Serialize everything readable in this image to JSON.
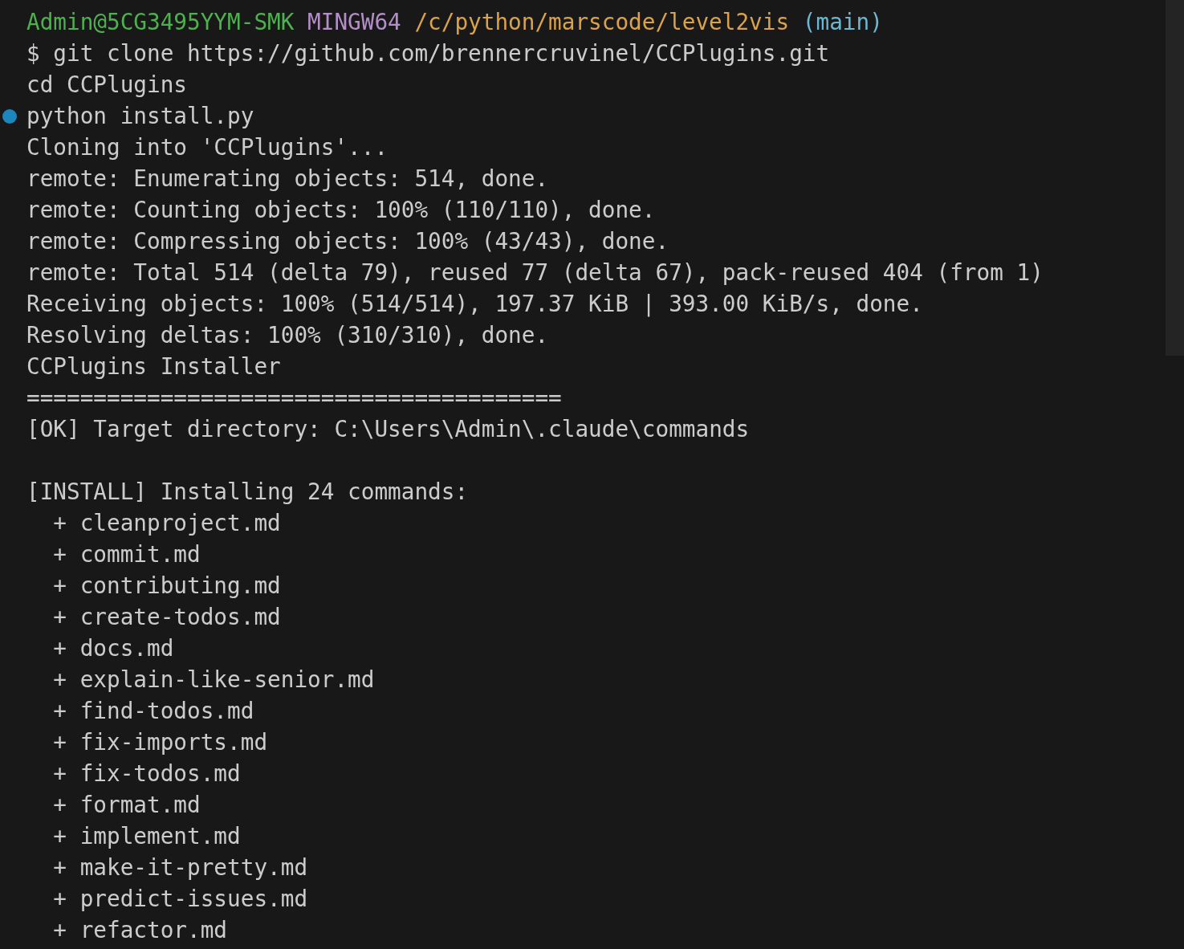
{
  "prompt": {
    "user_host": "Admin@5CG3495YYM-SMK",
    "system": "MINGW64",
    "path": "/c/python/marscode/level2vis",
    "branch": "(main)"
  },
  "commands": [
    {
      "text": "$ git clone https://github.com/brennercruvinel/CCPlugins.git",
      "marked": false
    },
    {
      "text": "cd CCPlugins",
      "marked": false
    },
    {
      "text": "python install.py",
      "marked": true
    }
  ],
  "output_blocks": [
    [
      "Cloning into 'CCPlugins'...",
      "remote: Enumerating objects: 514, done.",
      "remote: Counting objects: 100% (110/110), done.",
      "remote: Compressing objects: 100% (43/43), done.",
      "remote: Total 514 (delta 79), reused 77 (delta 67), pack-reused 404 (from 1)",
      "Receiving objects: 100% (514/514), 197.37 KiB | 393.00 KiB/s, done.",
      "Resolving deltas: 100% (310/310), done.",
      "CCPlugins Installer",
      "========================================",
      "[OK] Target directory: C:\\Users\\Admin\\.claude\\commands"
    ],
    [
      "[INSTALL] Installing 24 commands:",
      "  + cleanproject.md",
      "  + commit.md",
      "  + contributing.md",
      "  + create-todos.md",
      "  + docs.md",
      "  + explain-like-senior.md",
      "  + find-todos.md",
      "  + fix-imports.md",
      "  + fix-todos.md",
      "  + format.md",
      "  + implement.md",
      "  + make-it-pretty.md",
      "  + predict-issues.md",
      "  + refactor.md"
    ]
  ]
}
